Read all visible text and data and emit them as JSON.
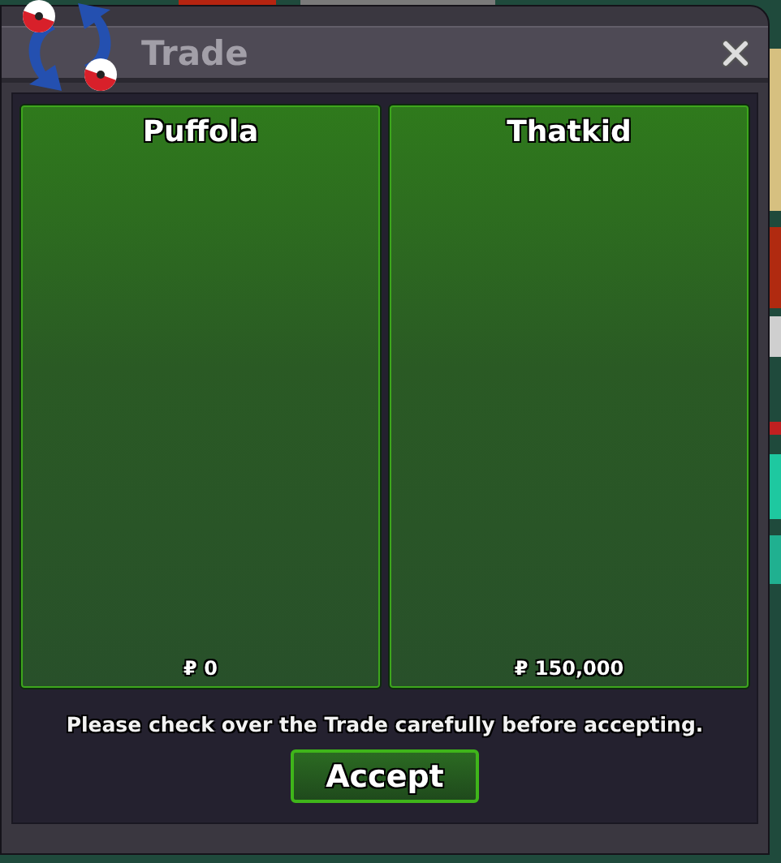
{
  "window": {
    "title": "Trade"
  },
  "offers": [
    {
      "name": "Puffola",
      "money": "₽ 0"
    },
    {
      "name": "Thatkid",
      "money": "₽ 150,000"
    }
  ],
  "notice": "Please check over the Trade carefully before accepting.",
  "buttons": [
    {
      "label": "Accept",
      "kind": "primary"
    }
  ]
}
